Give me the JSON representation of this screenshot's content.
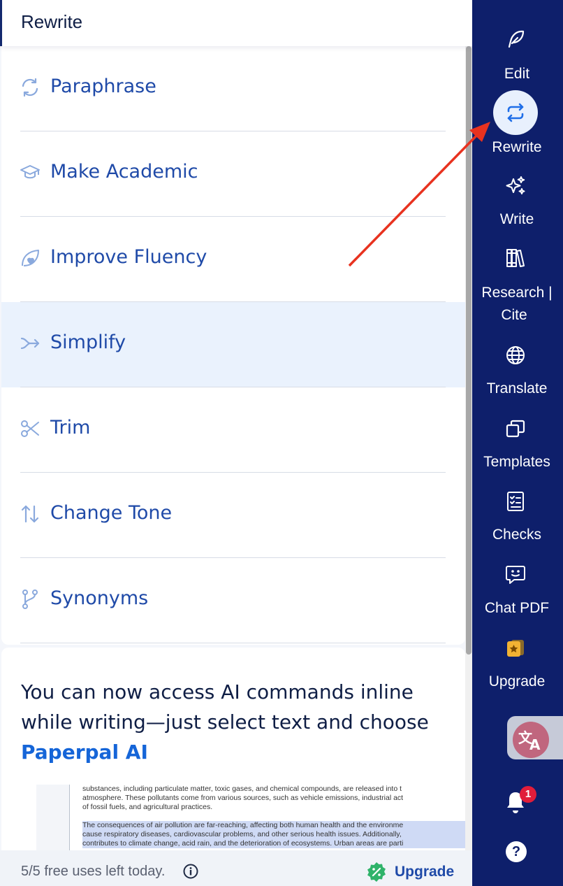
{
  "header": {
    "title": "Rewrite"
  },
  "menu": [
    {
      "label": "Paraphrase",
      "icon": "refresh-icon"
    },
    {
      "label": "Make Academic",
      "icon": "graduation-cap-icon"
    },
    {
      "label": "Improve Fluency",
      "icon": "leaf-heart-icon"
    },
    {
      "label": "Simplify",
      "icon": "merge-arrow-icon",
      "active": true
    },
    {
      "label": "Trim",
      "icon": "scissors-icon"
    },
    {
      "label": "Change Tone",
      "icon": "up-down-arrows-icon"
    },
    {
      "label": "Synonyms",
      "icon": "branch-icon"
    }
  ],
  "promo": {
    "text_before": "You can now access AI commands inline while writing—just select text and choose ",
    "link": "Paperpal AI",
    "doc_lines": [
      "substances, including particulate matter, toxic gases, and chemical compounds, are released into t",
      "atmosphere. These pollutants come from various sources, such as vehicle emissions, industrial act",
      "of fossil fuels, and agricultural practices.",
      "The consequences of air pollution are far-reaching, affecting both human health and the environme",
      "cause respiratory diseases, cardiovascular problems, and other serious health issues. Additionally,",
      "contributes to climate change, acid rain, and the deterioration of ecosystems. Urban areas are parti"
    ]
  },
  "footer": {
    "uses": "5/5 free uses left today.",
    "upgrade": "Upgrade"
  },
  "rail": {
    "edit": "Edit",
    "rewrite": "Rewrite",
    "write": "Write",
    "research_1": "Research |",
    "research_2": "Cite",
    "translate": "Translate",
    "templates": "Templates",
    "checks": "Checks",
    "chat_pdf": "Chat PDF",
    "upgrade": "Upgrade",
    "notifications_count": "1",
    "help": "?"
  },
  "colors": {
    "rail_bg": "#0e1f6b",
    "accent": "#1f4aa8",
    "link": "#1565d8",
    "active_bg": "#eaf2fd",
    "arrow": "#e8321f"
  }
}
